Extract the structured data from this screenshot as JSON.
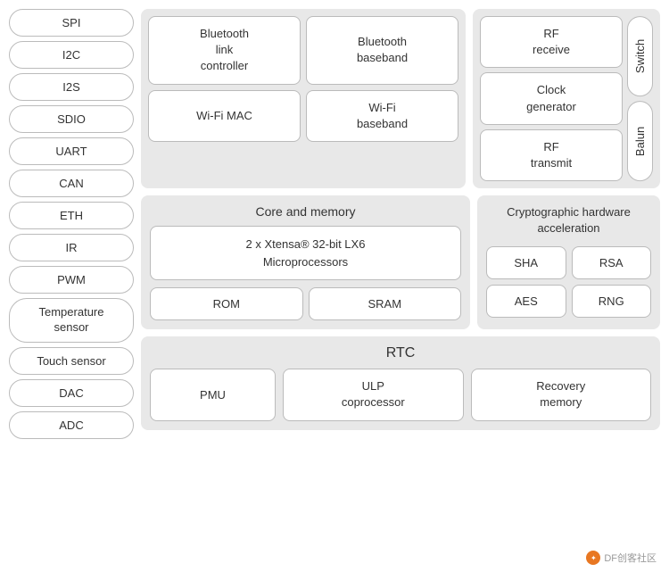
{
  "left": {
    "items": [
      "SPI",
      "I2C",
      "I2S",
      "SDIO",
      "UART",
      "CAN",
      "ETH",
      "IR",
      "PWM",
      "Temperature\nsensor",
      "Touch sensor",
      "DAC",
      "ADC"
    ]
  },
  "wireless": {
    "title": "",
    "row1": [
      "Bluetooth\nlink\ncontroller",
      "Bluetooth\nbaseband"
    ],
    "row2": [
      "Wi-Fi MAC",
      "Wi-Fi\nbaseband"
    ]
  },
  "rf": {
    "rf_receive": "RF\nreceive",
    "clock_gen": "Clock\ngenerator",
    "rf_transmit": "RF\ntransmit",
    "switch": "Switch",
    "balun": "Balun"
  },
  "core": {
    "title": "Core and memory",
    "processor": "2 x Xtensa® 32-bit LX6\nMicroprocessors",
    "rom": "ROM",
    "sram": "SRAM"
  },
  "crypto": {
    "title": "Cryptographic hardware\nacceleration",
    "items": [
      "SHA",
      "RSA",
      "AES",
      "RNG"
    ]
  },
  "rtc": {
    "title": "RTC",
    "pmu": "PMU",
    "ulp": "ULP\ncoprocessor",
    "recovery": "Recovery\nmemory"
  },
  "watermark": "DF创客社区"
}
